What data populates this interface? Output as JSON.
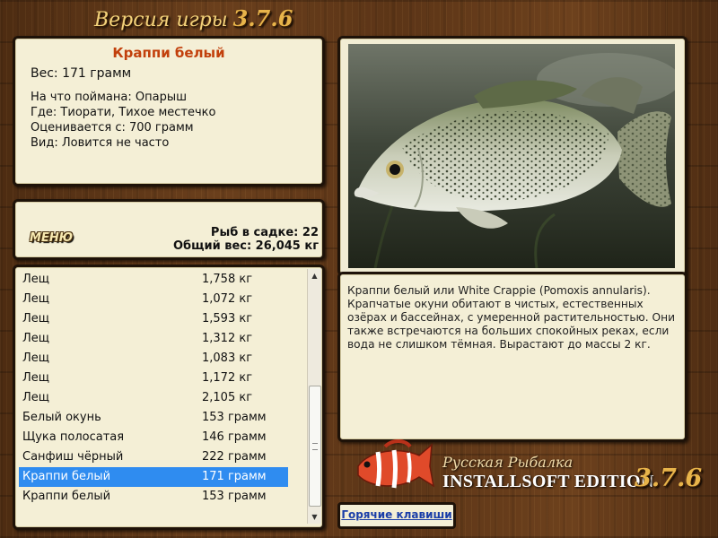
{
  "header": {
    "title": "Версия игры",
    "version": "3.7.6"
  },
  "fish_info": {
    "name": "Краппи белый",
    "weight": "Вес: 171 грамм",
    "bait": "На что поймана: Опарыш",
    "place": "Где: Тиорати, Тихое местечко",
    "value": "Оценивается с: 700 грамм",
    "kind": "Вид: Ловится не часто"
  },
  "catch": {
    "menu_label": "МЕНЮ",
    "count_label": "Рыб в садке: 22",
    "total_label": "Общий вес: 26,045 кг"
  },
  "fish_list": [
    {
      "name": "Лещ",
      "weight": "1,758 кг"
    },
    {
      "name": "Лещ",
      "weight": "1,072 кг"
    },
    {
      "name": "Лещ",
      "weight": "1,593 кг"
    },
    {
      "name": "Лещ",
      "weight": "1,312 кг"
    },
    {
      "name": "Лещ",
      "weight": "1,083 кг"
    },
    {
      "name": "Лещ",
      "weight": "1,172 кг"
    },
    {
      "name": "Лещ",
      "weight": "2,105 кг"
    },
    {
      "name": "Белый окунь",
      "weight": "153 грамм"
    },
    {
      "name": "Щука полосатая",
      "weight": "146 грамм"
    },
    {
      "name": "Санфиш чёрный",
      "weight": "222 грамм"
    },
    {
      "name": "Краппи белый",
      "weight": "171 грамм",
      "selected": true
    },
    {
      "name": "Краппи белый",
      "weight": "153 грамм"
    }
  ],
  "description": "Краппи белый или White Crappie (Pomoxis annularis). Крапчатые окуни обитают в чистых, естественных озёрах и бассейнах, с умеренной растительностью. Они также встречаются на больших спокойных реках, если вода не слишком тёмная. Вырастают до массы 2 кг.",
  "brand": {
    "line1": "Русская Рыбалка",
    "line2": "INSTALLSOFT EDITION",
    "version": "3.7.6"
  },
  "hotkeys_label": "Горячие клавиши",
  "colors": {
    "accent": "#c2400c",
    "selection": "#2f8cf0",
    "link": "#1a3ea8",
    "panel": "#f4efd6"
  }
}
